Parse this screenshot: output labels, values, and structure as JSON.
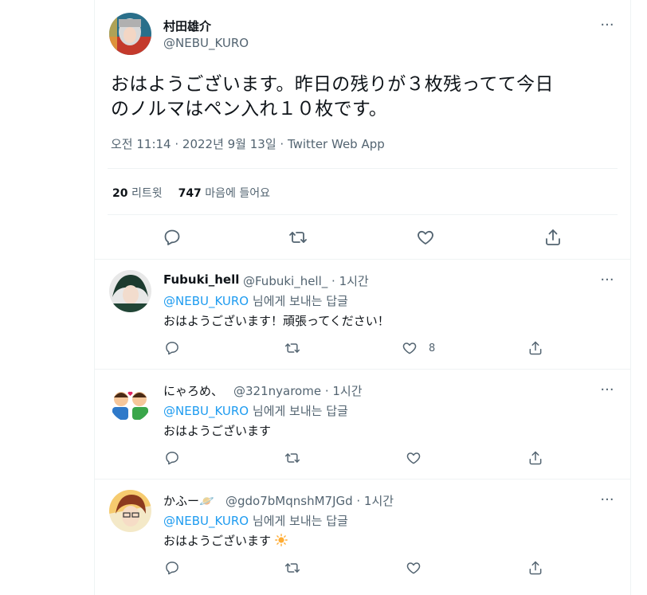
{
  "main_tweet": {
    "author_name": "村田雄介",
    "author_handle": "@NEBU_KURO",
    "text_line1": "おはようございます。昨日の残りが３枚残ってて今日",
    "text_line2": "のノルマはペン入れ１０枚です。",
    "meta": "오전 11:14 · 2022년 9월 13일 · Twitter Web App",
    "retweet_count": "20",
    "retweet_label": "리트윗",
    "like_count": "747",
    "like_label": "마음에 들어요",
    "more_label": "···"
  },
  "replies": [
    {
      "name": "Fubuki_hell",
      "handle": "@Fubuki_hell_ · 1시간",
      "mention": "@NEBU_KURO",
      "reply_suffix": "님에게 보내는 답글",
      "text": "おはようございます！頑張ってください！",
      "likes": "8",
      "more_label": "···"
    },
    {
      "name": "にゃろめ、",
      "handle": "@321nyarome · 1시간",
      "mention": "@NEBU_KURO",
      "reply_suffix": "님에게 보내는 답글",
      "text": "おはようございます",
      "likes": "",
      "more_label": "···"
    },
    {
      "name": "かふー🪐",
      "handle": "@gdo7bMqnshM7JGd · 1시간",
      "mention": "@NEBU_KURO",
      "reply_suffix": "님에게 보내는 답글",
      "text": "おはようございます",
      "likes": "",
      "more_label": "···"
    }
  ],
  "colors": {
    "accent": "#1d9bf0",
    "secondary_text": "#536471",
    "divider": "#eff3f4"
  },
  "icons": [
    "reply-icon",
    "retweet-icon",
    "like-icon",
    "share-icon",
    "more-icon",
    "sun-emoji-icon"
  ]
}
